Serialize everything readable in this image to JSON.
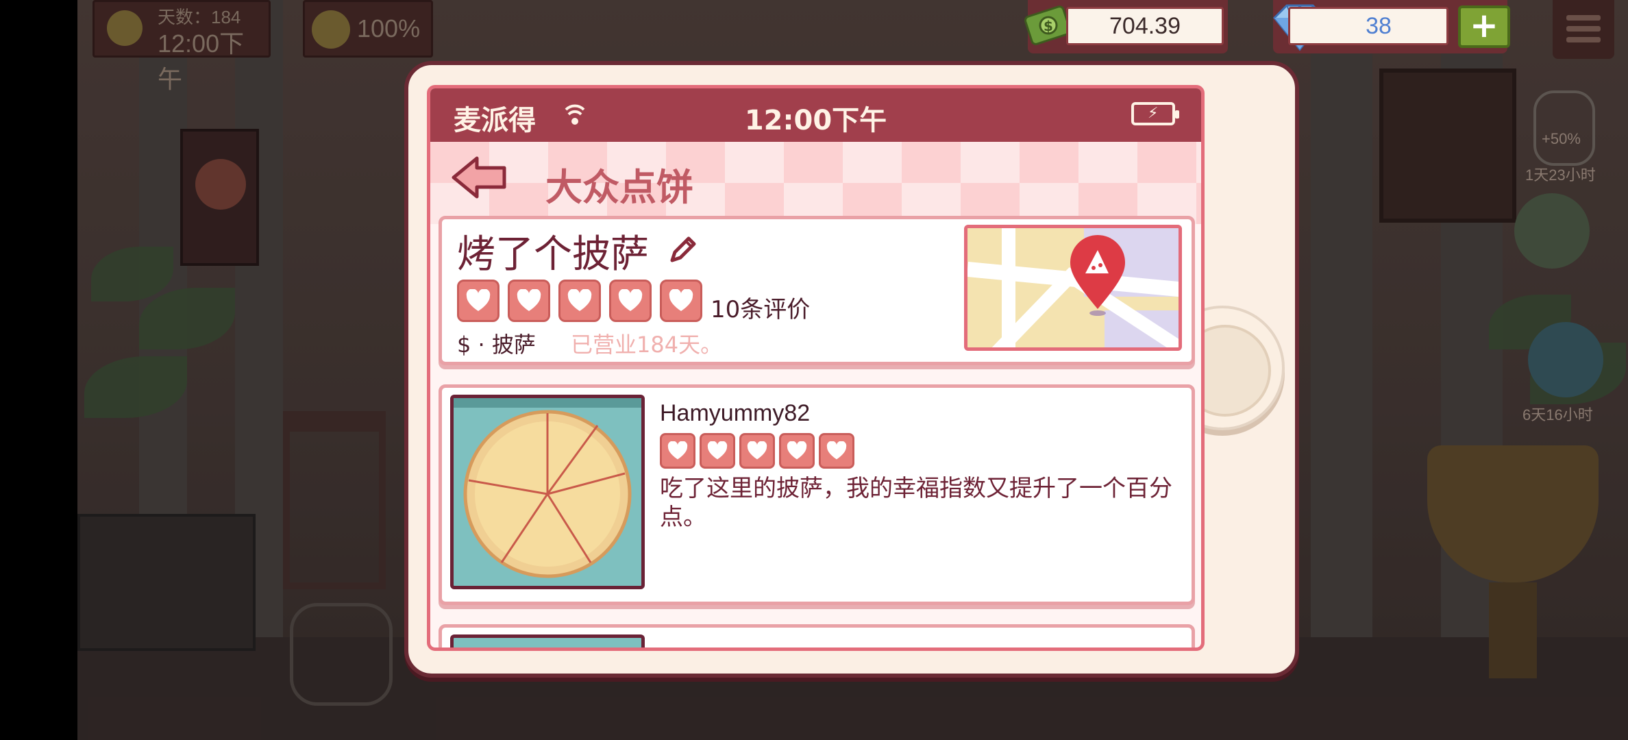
{
  "hud": {
    "days_label": "天数：184",
    "clock": "12:00下午",
    "mood": "100%",
    "money": "704.39",
    "gems": "38",
    "plus": "+"
  },
  "side_items": [
    {
      "label": "1天23小时",
      "badge": "+50%"
    },
    {
      "label": "6天16小时"
    }
  ],
  "phone": {
    "status": {
      "carrier": "麦派得",
      "time": "12:00下午"
    },
    "page_title": "大众点饼",
    "shop": {
      "name": "烤了个披萨",
      "hearts": 5,
      "review_count": "10条评价",
      "price_category": "$ · 披萨",
      "open_days": "已营业184天。"
    },
    "reviews": [
      {
        "username": "Hamyummy82",
        "hearts": 5,
        "text": "吃了这里的披萨，我的幸福指数又提升了一个百分点。"
      }
    ]
  },
  "colors": {
    "status_bar": "#a13f4c",
    "heart": "#e77f7a",
    "title_pink": "#c05a64",
    "gem_blue": "#4f7fd1",
    "plus_green": "#7fa335"
  }
}
